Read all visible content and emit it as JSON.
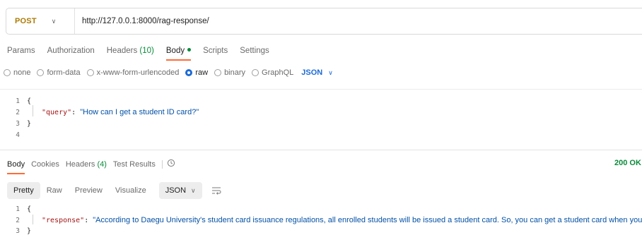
{
  "request": {
    "method": "POST",
    "url": "http://127.0.0.1:8000/rag-response/"
  },
  "request_tabs": [
    {
      "label": "Params"
    },
    {
      "label": "Authorization"
    },
    {
      "label": "Headers",
      "count": "(10)"
    },
    {
      "label": "Body"
    },
    {
      "label": "Scripts"
    },
    {
      "label": "Settings"
    }
  ],
  "body_types": {
    "options": [
      "none",
      "form-data",
      "x-www-form-urlencoded",
      "raw",
      "binary",
      "GraphQL"
    ],
    "selected": "raw",
    "format": "JSON"
  },
  "request_body": {
    "line_numbers": [
      "1",
      "2",
      "3",
      "4"
    ],
    "open_brace": "{",
    "key": "\"query\"",
    "colon": ":",
    "value": "\"How can I get a student ID card?\"",
    "close_brace": "}"
  },
  "response_tabs": [
    {
      "label": "Body"
    },
    {
      "label": "Cookies"
    },
    {
      "label": "Headers",
      "count": "(4)"
    },
    {
      "label": "Test Results"
    }
  ],
  "status": "200 OK",
  "response_views": [
    "Pretty",
    "Raw",
    "Preview",
    "Visualize"
  ],
  "response_format": "JSON",
  "response_body": {
    "line_numbers": [
      "1",
      "2",
      "3"
    ],
    "open_brace": "{",
    "key": "\"response\"",
    "colon": ":",
    "value": "\"According to Daegu University's student card issuance regulations, all enrolled students will be issued a student card. So, you can get a student card when you complete your registratior",
    "close_brace": "}"
  },
  "icons": {
    "method_dropdown": "chevron-down-icon",
    "history": "history-icon",
    "wrap": "wrap-lines-icon"
  },
  "colors": {
    "accent": "#ff6c37",
    "method": "#ad7a03",
    "selected": "#1c6ad6",
    "success": "#0a8a3a"
  }
}
